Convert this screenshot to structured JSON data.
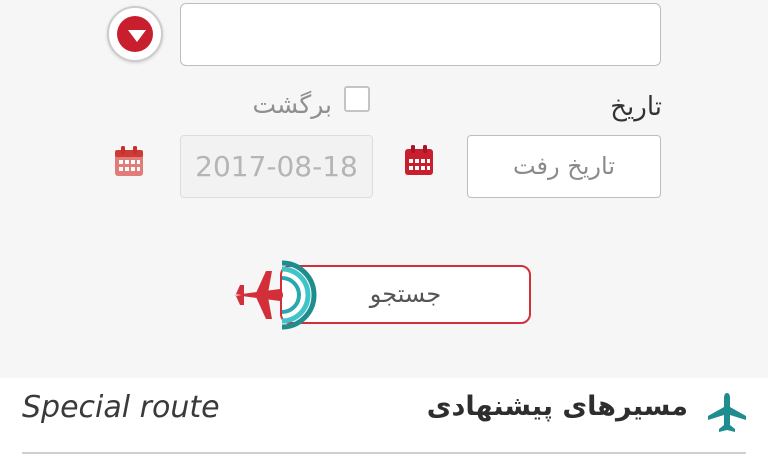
{
  "top_field": {
    "value": "",
    "toggle_icon": "chevron-down-icon"
  },
  "trip": {
    "date_label": "تاریخ",
    "return_label": "برگشت",
    "return_checked": false,
    "depart_placeholder": "تاریخ رفت",
    "return_date": "2017-08-18"
  },
  "search": {
    "label": "جستجو"
  },
  "special_routes": {
    "title_fa": "مسیرهای پیشنهادی",
    "title_en": "Special route"
  },
  "colors": {
    "accent_red": "#d32f3a",
    "accent_teal": "#1f8c8e",
    "background": "#f6f6f6"
  }
}
